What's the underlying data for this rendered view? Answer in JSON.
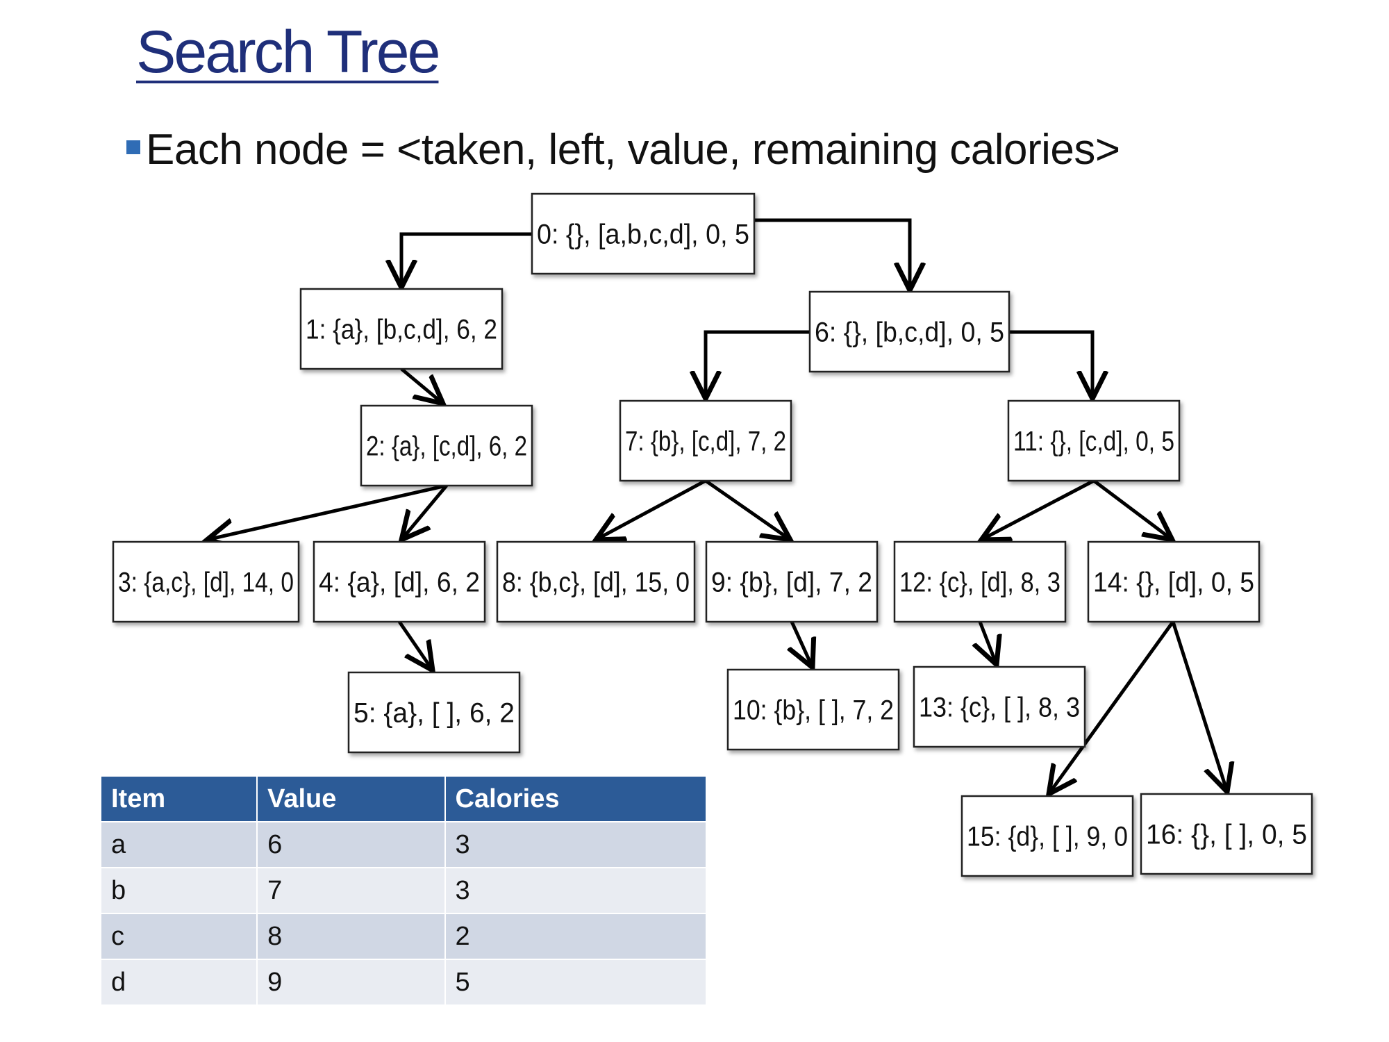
{
  "slide": {
    "title": "Search Tree",
    "bullet": "Each node = <taken, left, value, remaining calories>"
  },
  "tree": {
    "nodes": [
      {
        "id": 0,
        "label": "0: {}, [a,b,c,d], 0, 5"
      },
      {
        "id": 1,
        "label": "1: {a}, [b,c,d], 6, 2"
      },
      {
        "id": 2,
        "label": "2: {a}, [c,d], 6, 2"
      },
      {
        "id": 3,
        "label": "3: {a,c}, [d], 14, 0"
      },
      {
        "id": 4,
        "label": "4: {a}, [d], 6, 2"
      },
      {
        "id": 5,
        "label": "5: {a}, [ ], 6, 2"
      },
      {
        "id": 6,
        "label": "6: {}, [b,c,d], 0, 5"
      },
      {
        "id": 7,
        "label": "7: {b}, [c,d], 7, 2"
      },
      {
        "id": 8,
        "label": "8: {b,c}, [d], 15, 0"
      },
      {
        "id": 9,
        "label": "9: {b}, [d], 7, 2"
      },
      {
        "id": 10,
        "label": "10: {b}, [ ], 7, 2"
      },
      {
        "id": 11,
        "label": "11: {}, [c,d], 0, 5"
      },
      {
        "id": 12,
        "label": "12: {c}, [d], 8, 3"
      },
      {
        "id": 13,
        "label": "13: {c}, [ ], 8, 3"
      },
      {
        "id": 14,
        "label": "14: {}, [d], 0, 5"
      },
      {
        "id": 15,
        "label": "15: {d}, [ ], 9, 0"
      },
      {
        "id": 16,
        "label": "16: {}, [ ], 0, 5"
      }
    ],
    "edges": [
      [
        0,
        1
      ],
      [
        0,
        6
      ],
      [
        1,
        2
      ],
      [
        2,
        3
      ],
      [
        2,
        4
      ],
      [
        4,
        5
      ],
      [
        6,
        7
      ],
      [
        6,
        11
      ],
      [
        7,
        8
      ],
      [
        7,
        9
      ],
      [
        9,
        10
      ],
      [
        11,
        12
      ],
      [
        11,
        14
      ],
      [
        12,
        13
      ],
      [
        14,
        15
      ],
      [
        14,
        16
      ]
    ]
  },
  "table": {
    "headers": [
      "Item",
      "Value",
      "Calories"
    ],
    "rows": [
      [
        "a",
        "6",
        "3"
      ],
      [
        "b",
        "7",
        "3"
      ],
      [
        "c",
        "8",
        "2"
      ],
      [
        "d",
        "9",
        "5"
      ]
    ],
    "header_color": "#2c5b97"
  }
}
